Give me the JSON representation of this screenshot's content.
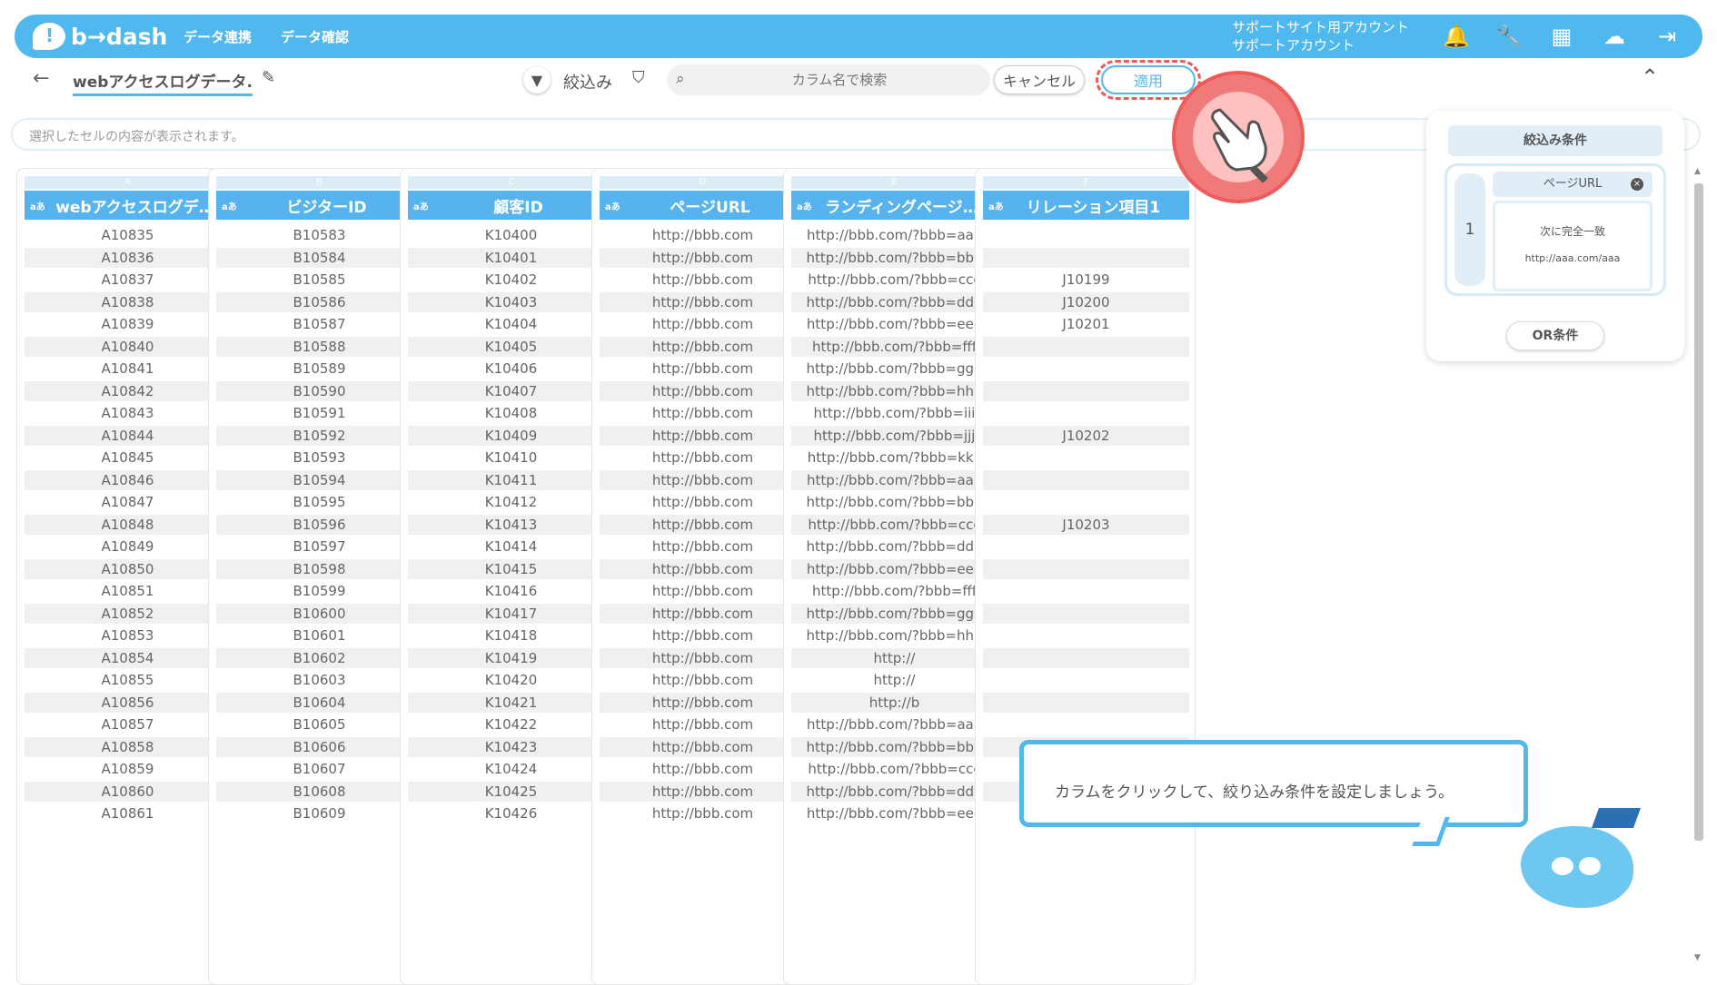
{
  "header": {
    "logo": "b→dash",
    "nav": [
      "データ連携",
      "データ確認"
    ],
    "account_line1": "サポートサイト用アカウント",
    "account_line2": "サポートアカウント",
    "icons": [
      "bell-icon",
      "wrench-icon",
      "grid-icon",
      "support-icon",
      "logout-icon"
    ]
  },
  "toolbar": {
    "back_icon": "←",
    "title": "webアクセスログデータ.",
    "filter_label": "絞込み",
    "search_placeholder": "カラム名で検索",
    "cancel_label": "キャンセル",
    "apply_label": "適用"
  },
  "cellbar": {
    "placeholder": "選択したセルの内容が表示されます。"
  },
  "table": {
    "columns": [
      {
        "letter": "A",
        "type": "aあ",
        "name": "webアクセスログデ…"
      },
      {
        "letter": "B",
        "type": "aあ",
        "name": "ビジターID"
      },
      {
        "letter": "C",
        "type": "aあ",
        "name": "顧客ID"
      },
      {
        "letter": "D",
        "type": "aあ",
        "name": "ページURL"
      },
      {
        "letter": "E",
        "type": "aあ",
        "name": "ランディングページ…"
      },
      {
        "letter": "F",
        "type": "aあ",
        "name": "リレーション項目1"
      }
    ],
    "rows": [
      [
        "A10835",
        "B10583",
        "K10400",
        "http://bbb.com",
        "http://bbb.com/?bbb=aaa",
        ""
      ],
      [
        "A10836",
        "B10584",
        "K10401",
        "http://bbb.com",
        "http://bbb.com/?bbb=bbb",
        ""
      ],
      [
        "A10837",
        "B10585",
        "K10402",
        "http://bbb.com",
        "http://bbb.com/?bbb=ccc",
        "J10199"
      ],
      [
        "A10838",
        "B10586",
        "K10403",
        "http://bbb.com",
        "http://bbb.com/?bbb=ddd",
        "J10200"
      ],
      [
        "A10839",
        "B10587",
        "K10404",
        "http://bbb.com",
        "http://bbb.com/?bbb=eee",
        "J10201"
      ],
      [
        "A10840",
        "B10588",
        "K10405",
        "http://bbb.com",
        "http://bbb.com/?bbb=fff",
        ""
      ],
      [
        "A10841",
        "B10589",
        "K10406",
        "http://bbb.com",
        "http://bbb.com/?bbb=ggg",
        ""
      ],
      [
        "A10842",
        "B10590",
        "K10407",
        "http://bbb.com",
        "http://bbb.com/?bbb=hhh",
        ""
      ],
      [
        "A10843",
        "B10591",
        "K10408",
        "http://bbb.com",
        "http://bbb.com/?bbb=iii",
        ""
      ],
      [
        "A10844",
        "B10592",
        "K10409",
        "http://bbb.com",
        "http://bbb.com/?bbb=jjj",
        "J10202"
      ],
      [
        "A10845",
        "B10593",
        "K10410",
        "http://bbb.com",
        "http://bbb.com/?bbb=kkk",
        ""
      ],
      [
        "A10846",
        "B10594",
        "K10411",
        "http://bbb.com",
        "http://bbb.com/?bbb=aaa",
        ""
      ],
      [
        "A10847",
        "B10595",
        "K10412",
        "http://bbb.com",
        "http://bbb.com/?bbb=bbb",
        ""
      ],
      [
        "A10848",
        "B10596",
        "K10413",
        "http://bbb.com",
        "http://bbb.com/?bbb=ccc",
        "J10203"
      ],
      [
        "A10849",
        "B10597",
        "K10414",
        "http://bbb.com",
        "http://bbb.com/?bbb=ddd",
        ""
      ],
      [
        "A10850",
        "B10598",
        "K10415",
        "http://bbb.com",
        "http://bbb.com/?bbb=eee",
        ""
      ],
      [
        "A10851",
        "B10599",
        "K10416",
        "http://bbb.com",
        "http://bbb.com/?bbb=fff",
        ""
      ],
      [
        "A10852",
        "B10600",
        "K10417",
        "http://bbb.com",
        "http://bbb.com/?bbb=ggg",
        ""
      ],
      [
        "A10853",
        "B10601",
        "K10418",
        "http://bbb.com",
        "http://bbb.com/?bbb=hhh",
        ""
      ],
      [
        "A10854",
        "B10602",
        "K10419",
        "http://bbb.com",
        "http://",
        ""
      ],
      [
        "A10855",
        "B10603",
        "K10420",
        "http://bbb.com",
        "http://",
        ""
      ],
      [
        "A10856",
        "B10604",
        "K10421",
        "http://bbb.com",
        "http://b",
        ""
      ],
      [
        "A10857",
        "B10605",
        "K10422",
        "http://bbb.com",
        "http://bbb.com/?bbb=aaa",
        ""
      ],
      [
        "A10858",
        "B10606",
        "K10423",
        "http://bbb.com",
        "http://bbb.com/?bbb=bbb",
        ""
      ],
      [
        "A10859",
        "B10607",
        "K10424",
        "http://bbb.com",
        "http://bbb.com/?bbb=ccc",
        ""
      ],
      [
        "A10860",
        "B10608",
        "K10425",
        "http://bbb.com",
        "http://bbb.com/?bbb=ddd",
        ""
      ],
      [
        "A10861",
        "B10609",
        "K10426",
        "http://bbb.com",
        "http://bbb.com/?bbb=eee",
        ""
      ]
    ]
  },
  "filter_panel": {
    "title": "絞込み条件",
    "condition_number": "1",
    "field": "ページURL",
    "operator": "次に完全一致",
    "value": "http://aaa.com/aaa",
    "or_label": "OR条件"
  },
  "tip": {
    "text": "カラムをクリックして、絞り込み条件を設定しましょう。"
  },
  "colors": {
    "brand": "#4fb8ef",
    "highlight": "#ef5a5a"
  }
}
